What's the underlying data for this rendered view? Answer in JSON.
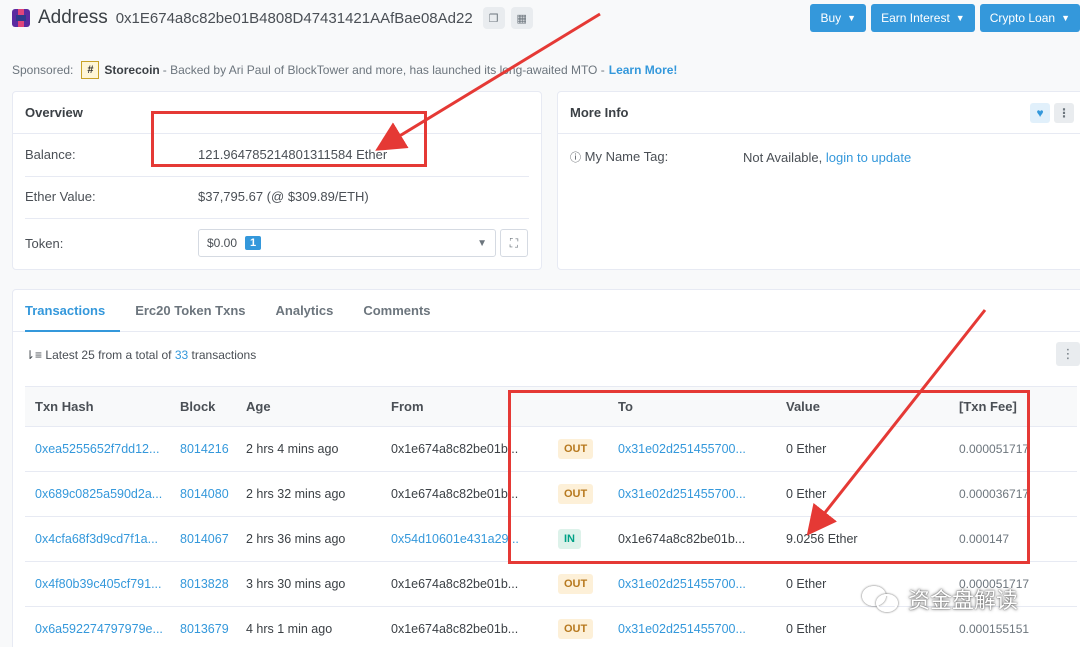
{
  "header": {
    "title": "Address",
    "address": "0x1E674a8c82be01B4808D47431421AAfBae08Ad22",
    "copy_icon": "copy-icon",
    "qr_icon": "qr-code-icon",
    "buttons": [
      {
        "label": "Buy"
      },
      {
        "label": "Earn Interest"
      },
      {
        "label": "Crypto Loan"
      }
    ]
  },
  "sponsored": {
    "prefix": "Sponsored:",
    "logo_text": "#",
    "brand": "Storecoin",
    "text": "- Backed by Ari Paul of BlockTower and more, has launched its long-awaited MTO -",
    "link": "Learn More!"
  },
  "overview": {
    "title": "Overview",
    "balance_label": "Balance:",
    "balance_value": "121.964785214801311584 Ether",
    "ether_value_label": "Ether Value:",
    "ether_value": "$37,795.67 (@ $309.89/ETH)",
    "token_label": "Token:",
    "token_value": "$0.00",
    "token_count": "1"
  },
  "more_info": {
    "title": "More Info",
    "name_tag_label": "My Name Tag:",
    "name_tag_value": "Not Available,",
    "name_tag_link": "login to update"
  },
  "tabs": [
    {
      "label": "Transactions",
      "active": true
    },
    {
      "label": "Erc20 Token Txns",
      "active": false
    },
    {
      "label": "Analytics",
      "active": false
    },
    {
      "label": "Comments",
      "active": false
    }
  ],
  "summary": {
    "prefix": "Latest 25 from a total of",
    "count": "33",
    "suffix": "transactions"
  },
  "table": {
    "headers": [
      "Txn Hash",
      "Block",
      "Age",
      "From",
      "",
      "To",
      "Value",
      "[Txn Fee]"
    ],
    "rows": [
      {
        "hash": "0xea5255652f7dd12...",
        "block": "8014216",
        "age": "2 hrs 4 mins ago",
        "from": "0x1e674a8c82be01b...",
        "dir": "OUT",
        "to": "0x31e02d251455700...",
        "value": "0 Ether",
        "fee": "0.000051717"
      },
      {
        "hash": "0x689c0825a590d2a...",
        "block": "8014080",
        "age": "2 hrs 32 mins ago",
        "from": "0x1e674a8c82be01b...",
        "dir": "OUT",
        "to": "0x31e02d251455700...",
        "value": "0 Ether",
        "fee": "0.000036717"
      },
      {
        "hash": "0x4cfa68f3d9cd7f1a...",
        "block": "8014067",
        "age": "2 hrs 36 mins ago",
        "from": "0x54d10601e431a29...",
        "dir": "IN",
        "to": "0x1e674a8c82be01b...",
        "value": "9.0256 Ether",
        "fee": "0.000147"
      },
      {
        "hash": "0x4f80b39c405cf791...",
        "block": "8013828",
        "age": "3 hrs 30 mins ago",
        "from": "0x1e674a8c82be01b...",
        "dir": "OUT",
        "to": "0x31e02d251455700...",
        "value": "0 Ether",
        "fee": "0.000051717"
      },
      {
        "hash": "0x6a592274797979e...",
        "block": "8013679",
        "age": "4 hrs 1 min ago",
        "from": "0x1e674a8c82be01b...",
        "dir": "OUT",
        "to": "0x31e02d251455700...",
        "value": "0 Ether",
        "fee": "0.000155151"
      }
    ]
  },
  "watermark": {
    "text": "资金盘解读"
  },
  "colors": {
    "accent": "#3498db",
    "annotation": "#e53935",
    "out_badge": "#fdf0d8",
    "in_badge": "#ddf2ea"
  }
}
